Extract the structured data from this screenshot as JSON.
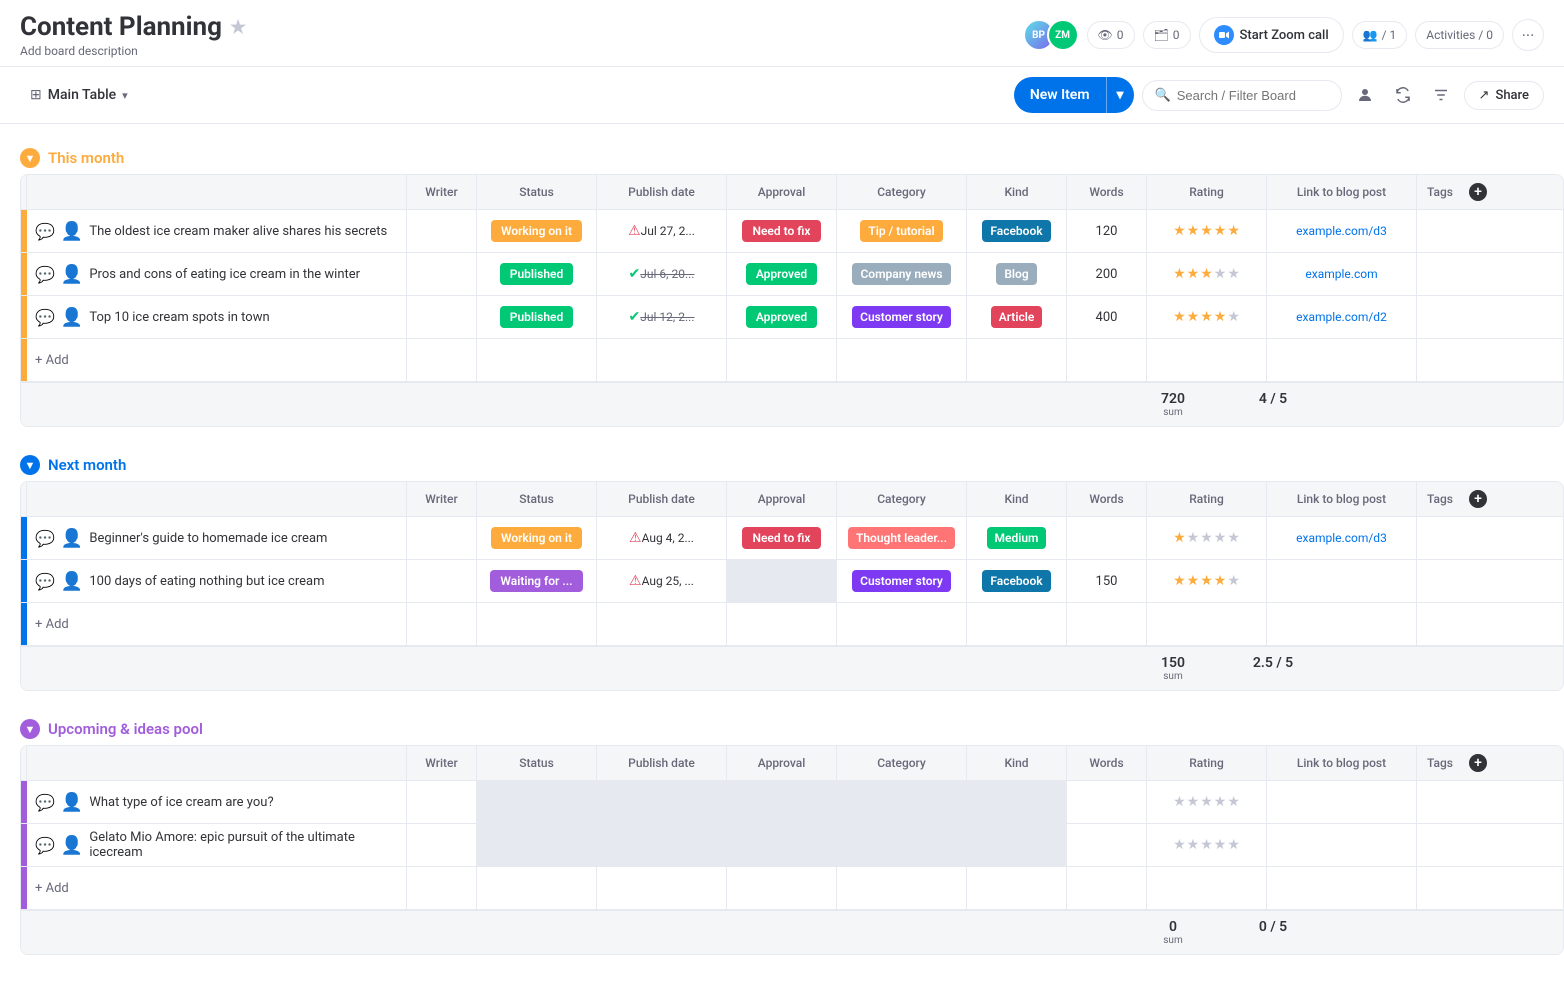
{
  "header": {
    "title": "Content Planning",
    "subtitle": "Add board description",
    "star_label": "★",
    "avatars": [
      "BP",
      "ZM"
    ],
    "reactions_count": "0",
    "invite_count": "0",
    "zoom_label": "Start Zoom call",
    "members_count": "1",
    "activities_label": "Activities / 0",
    "more_label": "···"
  },
  "toolbar": {
    "main_table_label": "Main Table",
    "new_item_label": "New Item",
    "search_placeholder": "Search / Filter Board",
    "share_label": "Share"
  },
  "groups": [
    {
      "id": "this_month",
      "title": "This month",
      "color": "#fdab3d",
      "columns": [
        "Writer",
        "Status",
        "Publish date",
        "Approval",
        "Category",
        "Kind",
        "Words",
        "Rating",
        "Link to blog post",
        "Tags"
      ],
      "rows": [
        {
          "item": "The oldest ice cream maker alive shares his secrets",
          "status": "Working on it",
          "status_class": "status-working",
          "date": "Jul 27, 2...",
          "date_icon": "warning",
          "approval": "Need to fix",
          "approval_class": "approval-fix",
          "category": "Tip / tutorial",
          "category_class": "cat-tip",
          "kind": "Facebook",
          "kind_class": "kind-facebook",
          "words": "120",
          "rating": 5,
          "link": "example.com/d3"
        },
        {
          "item": "Pros and cons of eating ice cream in the winter",
          "status": "Published",
          "status_class": "status-published",
          "date": "Jul 6, 20...",
          "date_icon": "check",
          "date_strike": true,
          "approval": "Approved",
          "approval_class": "approval-approved",
          "category": "Company news",
          "category_class": "cat-company",
          "kind": "Blog",
          "kind_class": "kind-blog",
          "words": "200",
          "rating": 3,
          "link": "example.com"
        },
        {
          "item": "Top 10 ice cream spots in town",
          "status": "Published",
          "status_class": "status-published",
          "date": "Jul 12, 2...",
          "date_icon": "check",
          "date_strike": true,
          "approval": "Approved",
          "approval_class": "approval-approved",
          "category": "Customer story",
          "category_class": "cat-customer",
          "kind": "Article",
          "kind_class": "kind-article",
          "words": "400",
          "rating": 4,
          "link": "example.com/d2"
        }
      ],
      "summary_words": "720",
      "summary_rating": "4 / 5"
    },
    {
      "id": "next_month",
      "title": "Next month",
      "color": "#0073ea",
      "columns": [
        "Writer",
        "Status",
        "Publish date",
        "Approval",
        "Category",
        "Kind",
        "Words",
        "Rating",
        "Link to blog post",
        "Tags"
      ],
      "rows": [
        {
          "item": "Beginner's guide to homemade ice cream",
          "status": "Working on it",
          "status_class": "status-working",
          "date": "Aug 4, 2...",
          "date_icon": "warning",
          "approval": "Need to fix",
          "approval_class": "approval-fix",
          "category": "Thought leader...",
          "category_class": "cat-thought",
          "kind": "Medium",
          "kind_class": "kind-medium",
          "words": "",
          "rating": 1,
          "link": "example.com/d3"
        },
        {
          "item": "100 days of eating nothing but ice cream",
          "status": "Waiting for ...",
          "status_class": "status-waiting",
          "date": "Aug 25, ...",
          "date_icon": "warning",
          "approval": "",
          "approval_class": "",
          "category": "Customer story",
          "category_class": "cat-customer",
          "kind": "Facebook",
          "kind_class": "kind-facebook",
          "words": "150",
          "rating": 4,
          "link": ""
        }
      ],
      "summary_words": "150",
      "summary_rating": "2.5 / 5"
    },
    {
      "id": "upcoming",
      "title": "Upcoming & ideas pool",
      "color": "#a25ddc",
      "columns": [
        "Writer",
        "Status",
        "Publish date",
        "Approval",
        "Category",
        "Kind",
        "Words",
        "Rating",
        "Link to blog post",
        "Tags"
      ],
      "rows": [
        {
          "item": "What type of ice cream are you?",
          "status": "",
          "status_class": "",
          "date": "",
          "date_icon": "",
          "approval": "",
          "approval_class": "",
          "category": "",
          "category_class": "",
          "kind": "",
          "kind_class": "",
          "words": "",
          "rating": 0,
          "link": ""
        },
        {
          "item": "Gelato Mio Amore: epic pursuit of the ultimate icecream",
          "status": "",
          "status_class": "",
          "date": "",
          "date_icon": "",
          "approval": "",
          "approval_class": "",
          "category": "",
          "category_class": "",
          "kind": "",
          "kind_class": "",
          "words": "",
          "rating": 0,
          "link": ""
        }
      ],
      "summary_words": "0",
      "summary_rating": "0 / 5"
    }
  ],
  "add_row_label": "+ Add"
}
